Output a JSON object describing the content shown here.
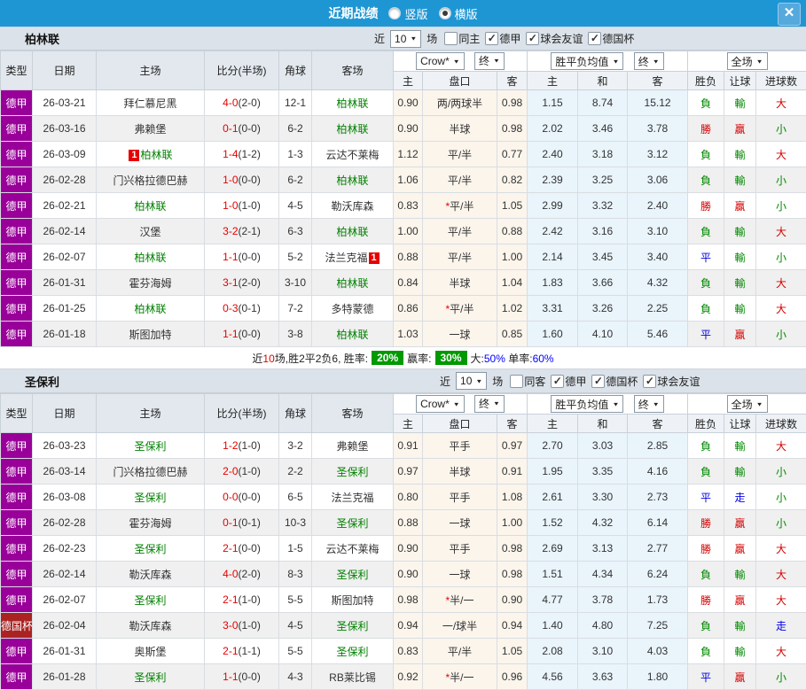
{
  "icons": {
    "dropdown_arrow": "▼",
    "close": "✕",
    "check": "✓"
  },
  "colors": {
    "titlebar_blue": "#1e96d3",
    "league_purple": "#990099",
    "cup_red": "#aa2222",
    "team_green": "#008000",
    "score_red": "#e60000",
    "badge_green": "#009900",
    "result_red": "#d40000",
    "result_green": "#008800",
    "result_blue": "#0000e6"
  },
  "titlebar": {
    "title": "近期战绩",
    "radios": [
      {
        "label": "竖版",
        "checked": false
      },
      {
        "label": "横版",
        "checked": true
      }
    ]
  },
  "common": {
    "near_label": "近",
    "matches_label": "场",
    "columns": [
      "类型",
      "日期",
      "主场",
      "比分(半场)",
      "角球",
      "客场",
      "主",
      "盘口",
      "客",
      "主",
      "和",
      "客",
      "胜负",
      "让球",
      "进球数"
    ],
    "selects": {
      "crown": "Crow*",
      "final1": "终",
      "avg": "胜平负均值",
      "final2": "终",
      "scope": "全场"
    }
  },
  "sections": [
    {
      "team": "柏林联",
      "count": "10",
      "filters": [
        {
          "label": "同主",
          "checked": false
        },
        {
          "label": "德甲",
          "checked": true
        },
        {
          "label": "球会友谊",
          "checked": true
        },
        {
          "label": "德国杯",
          "checked": true
        }
      ],
      "rows": [
        {
          "league": "德甲",
          "league_color": "#990099",
          "date": "26-03-21",
          "home": "拜仁慕尼黑",
          "home_green": false,
          "home_badge": "",
          "score": "4-0",
          "half": "(2-0)",
          "corner": "12-1",
          "away": "柏林联",
          "away_green": true,
          "away_badge": "",
          "odds": [
            "0.90",
            "两/两球半",
            "0.98"
          ],
          "avg": [
            "1.15",
            "8.74",
            "15.12"
          ],
          "result": [
            "負",
            "green"
          ],
          "handicap": [
            "輸",
            "green"
          ],
          "goals": [
            "大",
            "red"
          ]
        },
        {
          "league": "德甲",
          "league_color": "#990099",
          "date": "26-03-16",
          "home": "弗赖堡",
          "home_green": false,
          "home_badge": "",
          "score": "0-1",
          "half": "(0-0)",
          "corner": "6-2",
          "away": "柏林联",
          "away_green": true,
          "away_badge": "",
          "odds": [
            "0.90",
            "半球",
            "0.98"
          ],
          "avg": [
            "2.02",
            "3.46",
            "3.78"
          ],
          "result": [
            "勝",
            "red"
          ],
          "handicap": [
            "贏",
            "red"
          ],
          "goals": [
            "小",
            "green"
          ]
        },
        {
          "league": "德甲",
          "league_color": "#990099",
          "date": "26-03-09",
          "home": "柏林联",
          "home_green": true,
          "home_badge": "1",
          "score": "1-4",
          "half": "(1-2)",
          "corner": "1-3",
          "away": "云达不莱梅",
          "away_green": false,
          "away_badge": "",
          "odds": [
            "1.12",
            "平/半",
            "0.77"
          ],
          "avg": [
            "2.40",
            "3.18",
            "3.12"
          ],
          "result": [
            "負",
            "green"
          ],
          "handicap": [
            "輸",
            "green"
          ],
          "goals": [
            "大",
            "red"
          ]
        },
        {
          "league": "德甲",
          "league_color": "#990099",
          "date": "26-02-28",
          "home": "门兴格拉德巴赫",
          "home_green": false,
          "home_badge": "",
          "score": "1-0",
          "half": "(0-0)",
          "corner": "6-2",
          "away": "柏林联",
          "away_green": true,
          "away_badge": "",
          "odds": [
            "1.06",
            "平/半",
            "0.82"
          ],
          "avg": [
            "2.39",
            "3.25",
            "3.06"
          ],
          "result": [
            "負",
            "green"
          ],
          "handicap": [
            "輸",
            "green"
          ],
          "goals": [
            "小",
            "green"
          ]
        },
        {
          "league": "德甲",
          "league_color": "#990099",
          "date": "26-02-21",
          "home": "柏林联",
          "home_green": true,
          "home_badge": "",
          "score": "1-0",
          "half": "(1-0)",
          "corner": "4-5",
          "away": "勒沃库森",
          "away_green": false,
          "away_badge": "",
          "odds": [
            "0.83",
            "*平/半",
            "1.05"
          ],
          "avg": [
            "2.99",
            "3.32",
            "2.40"
          ],
          "result": [
            "勝",
            "red"
          ],
          "handicap": [
            "贏",
            "red"
          ],
          "goals": [
            "小",
            "green"
          ]
        },
        {
          "league": "德甲",
          "league_color": "#990099",
          "date": "26-02-14",
          "home": "汉堡",
          "home_green": false,
          "home_badge": "",
          "score": "3-2",
          "half": "(2-1)",
          "corner": "6-3",
          "away": "柏林联",
          "away_green": true,
          "away_badge": "",
          "odds": [
            "1.00",
            "平/半",
            "0.88"
          ],
          "avg": [
            "2.42",
            "3.16",
            "3.10"
          ],
          "result": [
            "負",
            "green"
          ],
          "handicap": [
            "輸",
            "green"
          ],
          "goals": [
            "大",
            "red"
          ]
        },
        {
          "league": "德甲",
          "league_color": "#990099",
          "date": "26-02-07",
          "home": "柏林联",
          "home_green": true,
          "home_badge": "",
          "score": "1-1",
          "half": "(0-0)",
          "corner": "5-2",
          "away": "法兰克福",
          "away_green": false,
          "away_badge": "1",
          "odds": [
            "0.88",
            "平/半",
            "1.00"
          ],
          "avg": [
            "2.14",
            "3.45",
            "3.40"
          ],
          "result": [
            "平",
            "blue"
          ],
          "handicap": [
            "輸",
            "green"
          ],
          "goals": [
            "小",
            "green"
          ]
        },
        {
          "league": "德甲",
          "league_color": "#990099",
          "date": "26-01-31",
          "home": "霍芬海姆",
          "home_green": false,
          "home_badge": "",
          "score": "3-1",
          "half": "(2-0)",
          "corner": "3-10",
          "away": "柏林联",
          "away_green": true,
          "away_badge": "",
          "odds": [
            "0.84",
            "半球",
            "1.04"
          ],
          "avg": [
            "1.83",
            "3.66",
            "4.32"
          ],
          "result": [
            "負",
            "green"
          ],
          "handicap": [
            "輸",
            "green"
          ],
          "goals": [
            "大",
            "red"
          ]
        },
        {
          "league": "德甲",
          "league_color": "#990099",
          "date": "26-01-25",
          "home": "柏林联",
          "home_green": true,
          "home_badge": "",
          "score": "0-3",
          "half": "(0-1)",
          "corner": "7-2",
          "away": "多特蒙德",
          "away_green": false,
          "away_badge": "",
          "odds": [
            "0.86",
            "*平/半",
            "1.02"
          ],
          "avg": [
            "3.31",
            "3.26",
            "2.25"
          ],
          "result": [
            "負",
            "green"
          ],
          "handicap": [
            "輸",
            "green"
          ],
          "goals": [
            "大",
            "red"
          ]
        },
        {
          "league": "德甲",
          "league_color": "#990099",
          "date": "26-01-18",
          "home": "斯图加特",
          "home_green": false,
          "home_badge": "",
          "score": "1-1",
          "half": "(0-0)",
          "corner": "3-8",
          "away": "柏林联",
          "away_green": true,
          "away_badge": "",
          "odds": [
            "1.03",
            "一球",
            "0.85"
          ],
          "avg": [
            "1.60",
            "4.10",
            "5.46"
          ],
          "result": [
            "平",
            "blue"
          ],
          "handicap": [
            "贏",
            "red"
          ],
          "goals": [
            "小",
            "green"
          ]
        }
      ],
      "summary": {
        "lead_near": "近",
        "lead_count": "10",
        "lead_rest": "场,胜2平2负6, ",
        "win_label": "胜率:",
        "win_value": "20%",
        "profit_label": "赢率:",
        "profit_value": "30%",
        "big_label": "大:",
        "big_value": "50%",
        "single_label": " 单率:",
        "single_value": "60%"
      }
    },
    {
      "team": "圣保利",
      "count": "10",
      "filters": [
        {
          "label": "同客",
          "checked": false
        },
        {
          "label": "德甲",
          "checked": true
        },
        {
          "label": "德国杯",
          "checked": true
        },
        {
          "label": "球会友谊",
          "checked": true
        }
      ],
      "rows": [
        {
          "league": "德甲",
          "league_color": "#990099",
          "date": "26-03-23",
          "home": "圣保利",
          "home_green": true,
          "home_badge": "",
          "score": "1-2",
          "half": "(1-0)",
          "corner": "3-2",
          "away": "弗赖堡",
          "away_green": false,
          "away_badge": "",
          "odds": [
            "0.91",
            "平手",
            "0.97"
          ],
          "avg": [
            "2.70",
            "3.03",
            "2.85"
          ],
          "result": [
            "負",
            "green"
          ],
          "handicap": [
            "輸",
            "green"
          ],
          "goals": [
            "大",
            "red"
          ]
        },
        {
          "league": "德甲",
          "league_color": "#990099",
          "date": "26-03-14",
          "home": "门兴格拉德巴赫",
          "home_green": false,
          "home_badge": "",
          "score": "2-0",
          "half": "(1-0)",
          "corner": "2-2",
          "away": "圣保利",
          "away_green": true,
          "away_badge": "",
          "odds": [
            "0.97",
            "半球",
            "0.91"
          ],
          "avg": [
            "1.95",
            "3.35",
            "4.16"
          ],
          "result": [
            "負",
            "green"
          ],
          "handicap": [
            "輸",
            "green"
          ],
          "goals": [
            "小",
            "green"
          ]
        },
        {
          "league": "德甲",
          "league_color": "#990099",
          "date": "26-03-08",
          "home": "圣保利",
          "home_green": true,
          "home_badge": "",
          "score": "0-0",
          "half": "(0-0)",
          "corner": "6-5",
          "away": "法兰克福",
          "away_green": false,
          "away_badge": "",
          "odds": [
            "0.80",
            "平手",
            "1.08"
          ],
          "avg": [
            "2.61",
            "3.30",
            "2.73"
          ],
          "result": [
            "平",
            "blue"
          ],
          "handicap": [
            "走",
            "blue"
          ],
          "goals": [
            "小",
            "green"
          ]
        },
        {
          "league": "德甲",
          "league_color": "#990099",
          "date": "26-02-28",
          "home": "霍芬海姆",
          "home_green": false,
          "home_badge": "",
          "score": "0-1",
          "half": "(0-1)",
          "corner": "10-3",
          "away": "圣保利",
          "away_green": true,
          "away_badge": "",
          "odds": [
            "0.88",
            "一球",
            "1.00"
          ],
          "avg": [
            "1.52",
            "4.32",
            "6.14"
          ],
          "result": [
            "勝",
            "red"
          ],
          "handicap": [
            "贏",
            "red"
          ],
          "goals": [
            "小",
            "green"
          ]
        },
        {
          "league": "德甲",
          "league_color": "#990099",
          "date": "26-02-23",
          "home": "圣保利",
          "home_green": true,
          "home_badge": "",
          "score": "2-1",
          "half": "(0-0)",
          "corner": "1-5",
          "away": "云达不莱梅",
          "away_green": false,
          "away_badge": "",
          "odds": [
            "0.90",
            "平手",
            "0.98"
          ],
          "avg": [
            "2.69",
            "3.13",
            "2.77"
          ],
          "result": [
            "勝",
            "red"
          ],
          "handicap": [
            "贏",
            "red"
          ],
          "goals": [
            "大",
            "red"
          ]
        },
        {
          "league": "德甲",
          "league_color": "#990099",
          "date": "26-02-14",
          "home": "勒沃库森",
          "home_green": false,
          "home_badge": "",
          "score": "4-0",
          "half": "(2-0)",
          "corner": "8-3",
          "away": "圣保利",
          "away_green": true,
          "away_badge": "",
          "odds": [
            "0.90",
            "一球",
            "0.98"
          ],
          "avg": [
            "1.51",
            "4.34",
            "6.24"
          ],
          "result": [
            "負",
            "green"
          ],
          "handicap": [
            "輸",
            "green"
          ],
          "goals": [
            "大",
            "red"
          ]
        },
        {
          "league": "德甲",
          "league_color": "#990099",
          "date": "26-02-07",
          "home": "圣保利",
          "home_green": true,
          "home_badge": "",
          "score": "2-1",
          "half": "(1-0)",
          "corner": "5-5",
          "away": "斯图加特",
          "away_green": false,
          "away_badge": "",
          "odds": [
            "0.98",
            "*半/一",
            "0.90"
          ],
          "avg": [
            "4.77",
            "3.78",
            "1.73"
          ],
          "result": [
            "勝",
            "red"
          ],
          "handicap": [
            "贏",
            "red"
          ],
          "goals": [
            "大",
            "red"
          ]
        },
        {
          "league": "德国杯",
          "league_color": "#aa2222",
          "date": "26-02-04",
          "home": "勒沃库森",
          "home_green": false,
          "home_badge": "",
          "score": "3-0",
          "half": "(1-0)",
          "corner": "4-5",
          "away": "圣保利",
          "away_green": true,
          "away_badge": "",
          "odds": [
            "0.94",
            "一/球半",
            "0.94"
          ],
          "avg": [
            "1.40",
            "4.80",
            "7.25"
          ],
          "result": [
            "負",
            "green"
          ],
          "handicap": [
            "輸",
            "green"
          ],
          "goals": [
            "走",
            "blue"
          ]
        },
        {
          "league": "德甲",
          "league_color": "#990099",
          "date": "26-01-31",
          "home": "奥斯堡",
          "home_green": false,
          "home_badge": "",
          "score": "2-1",
          "half": "(1-1)",
          "corner": "5-5",
          "away": "圣保利",
          "away_green": true,
          "away_badge": "",
          "odds": [
            "0.83",
            "平/半",
            "1.05"
          ],
          "avg": [
            "2.08",
            "3.10",
            "4.03"
          ],
          "result": [
            "負",
            "green"
          ],
          "handicap": [
            "輸",
            "green"
          ],
          "goals": [
            "大",
            "red"
          ]
        },
        {
          "league": "德甲",
          "league_color": "#990099",
          "date": "26-01-28",
          "home": "圣保利",
          "home_green": true,
          "home_badge": "",
          "score": "1-1",
          "half": "(0-0)",
          "corner": "4-3",
          "away": "RB莱比锡",
          "away_green": false,
          "away_badge": "",
          "odds": [
            "0.92",
            "*半/一",
            "0.96"
          ],
          "avg": [
            "4.56",
            "3.63",
            "1.80"
          ],
          "result": [
            "平",
            "blue"
          ],
          "handicap": [
            "贏",
            "red"
          ],
          "goals": [
            "小",
            "green"
          ]
        }
      ],
      "summary": null
    }
  ]
}
